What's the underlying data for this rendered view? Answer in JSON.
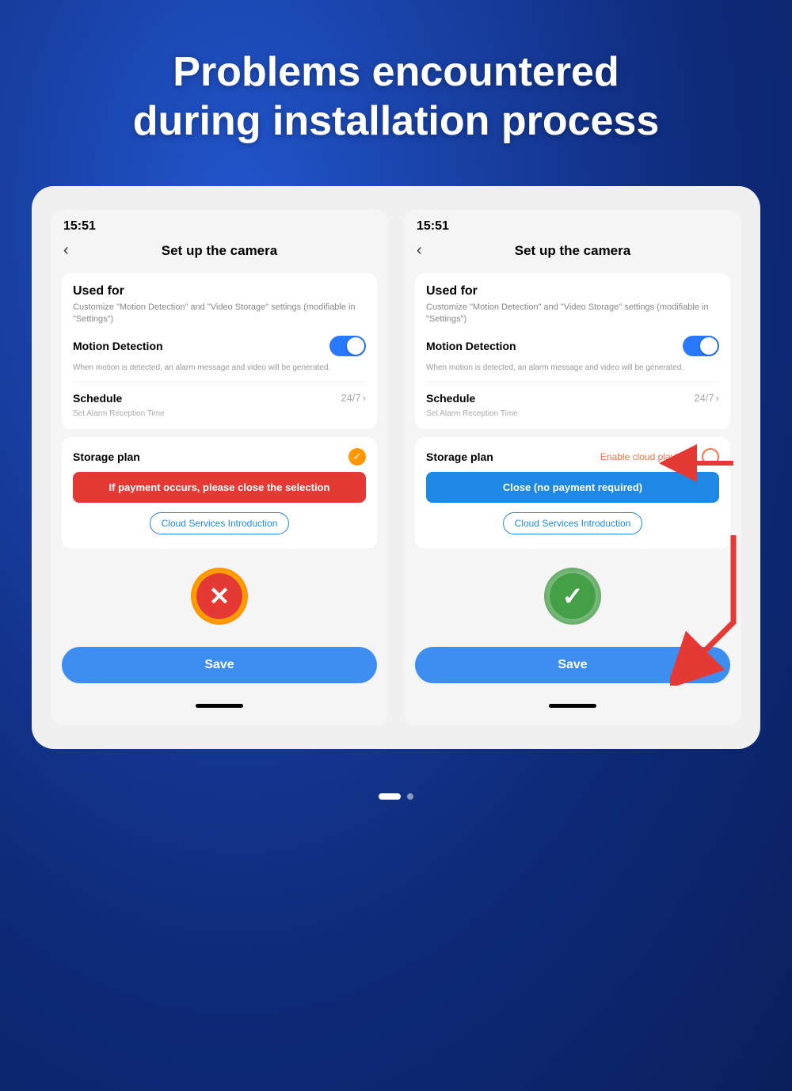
{
  "page": {
    "title_line1": "Problems encountered",
    "title_line2": "during installation process"
  },
  "left_screen": {
    "status_time": "15:51",
    "nav_back": "‹",
    "nav_title": "Set up  the camera",
    "used_for_title": "Used for",
    "used_for_subtitle": "Customize \"Motion Detection\" and \"Video Storage\" settings (modifiable in \"Settings\")",
    "motion_detection_label": "Motion Detection",
    "motion_detection_desc": "When motion is detected, an alarm message and video will be generated.",
    "schedule_label": "Schedule",
    "schedule_value": "24/7",
    "schedule_sub": "Set Alarm Reception Time",
    "storage_label": "Storage plan",
    "alert_text": "If payment occurs, please close the selection",
    "cloud_intro_btn": "Cloud Services Introduction",
    "save_btn": "Save"
  },
  "right_screen": {
    "status_time": "15:51",
    "nav_back": "‹",
    "nav_title": "Set up  the camera",
    "used_for_title": "Used for",
    "used_for_subtitle": "Customize \"Motion Detection\" and \"Video Storage\" settings (modifiable in \"Settings\")",
    "motion_detection_label": "Motion Detection",
    "motion_detection_desc": "When motion is detected, an alarm message and video will be generated.",
    "schedule_label": "Schedule",
    "schedule_value": "24/7",
    "schedule_sub": "Set Alarm Reception Time",
    "storage_label": "Storage plan",
    "enable_cloud_label": "Enable cloud playback",
    "close_btn": "Close (no payment required)",
    "cloud_intro_btn": "Cloud Services Introduction",
    "save_btn": "Save"
  },
  "icons": {
    "back_arrow": "‹",
    "chevron_right": "›",
    "checkmark": "✓",
    "x_mark": "✕"
  },
  "bottom_nav": {
    "dot_active": "●",
    "dot_inactive": "●"
  }
}
